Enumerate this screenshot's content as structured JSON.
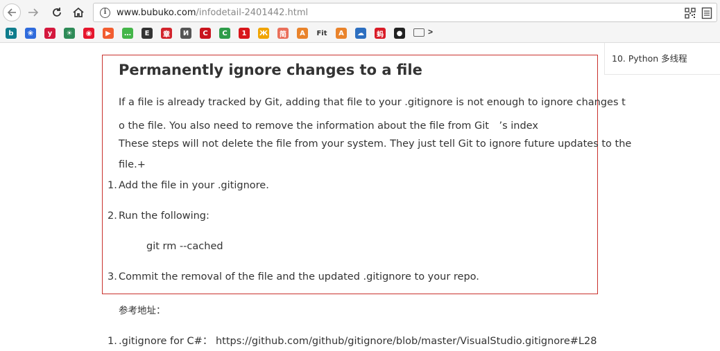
{
  "browser": {
    "url_host": "www.bubuko.com",
    "url_path": "/infodetail-2401442.html",
    "bookmarks": [
      {
        "icon": "bing-icon",
        "glyph": "b",
        "color": "#0f7c8c"
      },
      {
        "icon": "baidu-icon",
        "glyph": "❀",
        "color": "#2f6bdc"
      },
      {
        "icon": "yahoo-icon",
        "glyph": "y",
        "color": "#d4183d"
      },
      {
        "icon": "zhihu-icon",
        "glyph": "☀",
        "color": "#2e8b57"
      },
      {
        "icon": "weibo-icon",
        "glyph": "◉",
        "color": "#e6162d"
      },
      {
        "icon": "bilibili-icon",
        "glyph": "▶",
        "color": "#f25d30"
      },
      {
        "icon": "wechat-icon",
        "glyph": "…",
        "color": "#44b549"
      },
      {
        "icon": "tool-icon",
        "glyph": "E",
        "color": "#333333"
      },
      {
        "icon": "news-icon",
        "glyph": "章",
        "color": "#d2242c"
      },
      {
        "icon": "design-icon",
        "glyph": "И",
        "color": "#555555"
      },
      {
        "icon": "csdn-icon",
        "glyph": "C",
        "color": "#c9151e"
      },
      {
        "icon": "cnblogs-icon",
        "glyph": "C",
        "color": "#2e9c4a"
      },
      {
        "icon": "one-icon",
        "glyph": "1",
        "color": "#d8161b"
      },
      {
        "icon": "swirl-icon",
        "glyph": "Ж",
        "color": "#f0a400"
      },
      {
        "icon": "jianshu-icon",
        "glyph": "简",
        "color": "#ea6f5a"
      },
      {
        "icon": "a-icon",
        "glyph": "A",
        "color": "#e9832b"
      },
      {
        "icon": "fit-icon",
        "glyph": "Fit",
        "color": "transparent"
      },
      {
        "icon": "a2-icon",
        "glyph": "A",
        "color": "#e9832b"
      },
      {
        "icon": "onedrive-icon",
        "glyph": "☁",
        "color": "#2d6fc0"
      },
      {
        "icon": "ant-icon",
        "glyph": "蚂",
        "color": "#d91c27"
      },
      {
        "icon": "github-icon",
        "glyph": "●",
        "color": "#222222"
      },
      {
        "icon": "folder-icon",
        "glyph": "",
        "color": "#f5f5f5"
      }
    ],
    "more_label": ">"
  },
  "article": {
    "heading": "Permanently ignore changes to a file",
    "para1": "If a file is already tracked by Git, adding that file to your .gitignore is not enough to ignore changes t",
    "para2": "o the file. You also need to remove the information about the file from Git　’s index",
    "para3": "These steps will not delete the file from your system. They just tell Git to ignore future updates to the",
    "para4": "file.+",
    "steps": [
      {
        "num": "1.",
        "text": "Add the file in your .gitignore."
      },
      {
        "num": "2.",
        "text": "Run the following:"
      },
      {
        "num": "3.",
        "text": "Commit the removal of the file and the updated .gitignore to your repo."
      }
    ],
    "code": "git rm --cached"
  },
  "references": {
    "label": "参考地址：",
    "items": [
      {
        "num": "1.",
        "prefix": ".gitignore for C#： ",
        "url": "https://github.com/github/gitignore/blob/master/VisualStudio.gitignore#L28"
      }
    ]
  },
  "toc": {
    "items": [
      "10.  Python 多线程"
    ]
  }
}
